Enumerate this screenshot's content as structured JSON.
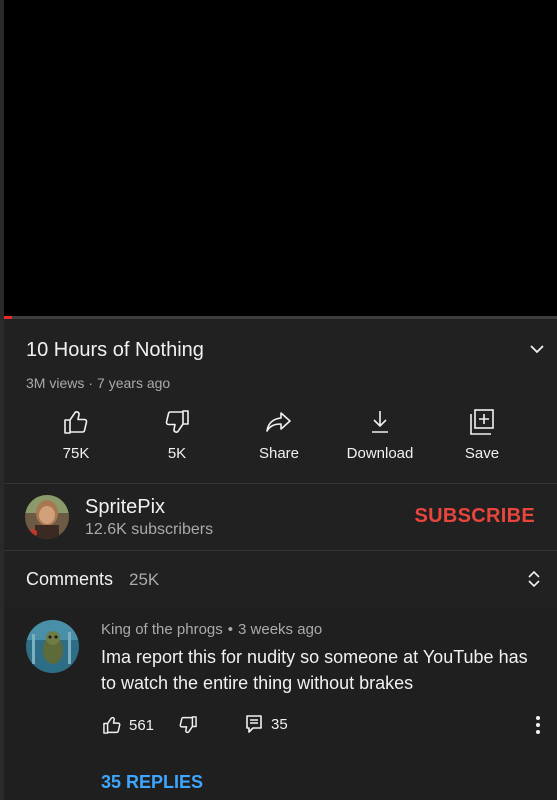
{
  "video": {
    "title": "10 Hours of Nothing",
    "views": "3M views",
    "age": "7 years ago",
    "progress_fraction": 0.015
  },
  "actions": [
    {
      "label": "75K",
      "icon": "thumbs-up-icon"
    },
    {
      "label": "5K",
      "icon": "thumbs-down-icon"
    },
    {
      "label": "Share",
      "icon": "share-icon"
    },
    {
      "label": "Download",
      "icon": "download-icon"
    },
    {
      "label": "Save",
      "icon": "save-playlist-icon"
    }
  ],
  "channel": {
    "name": "SpritePix",
    "subscribers": "12.6K subscribers",
    "subscribe_label": "SUBSCRIBE"
  },
  "comments": {
    "title": "Comments",
    "count": "25K",
    "items": [
      {
        "author": "King of the phrogs",
        "age": "3 weeks ago",
        "text": "Ima report this for nudity so someone at YouTube has to watch the entire thing without brakes",
        "likes": "561",
        "replies_count": "35",
        "replies_link": "35 REPLIES"
      }
    ]
  },
  "colors": {
    "background": "#202020",
    "subscribe": "#e8453c",
    "link": "#3ea6ff",
    "progress": "#e52d27"
  }
}
